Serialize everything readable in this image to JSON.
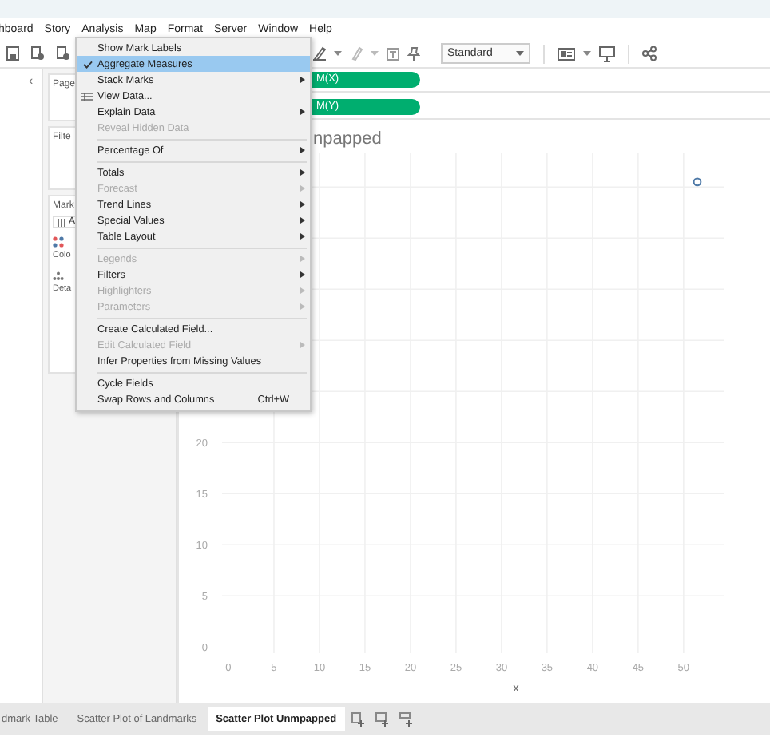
{
  "menubar": {
    "items": [
      {
        "label": "hboard"
      },
      {
        "label": "Story"
      },
      {
        "label": "Analysis"
      },
      {
        "label": "Map"
      },
      {
        "label": "Format"
      },
      {
        "label": "Server"
      },
      {
        "label": "Window"
      },
      {
        "label": "Help"
      }
    ]
  },
  "toolbar": {
    "mark_size": "Standard"
  },
  "data_pane": {
    "collapse": "‹"
  },
  "cards": {
    "pages": "Page",
    "filters": "Filte",
    "marks": "Mark",
    "marks_type": "A",
    "color_label": "Colo",
    "detail_label": "Deta"
  },
  "shelves": {
    "columns_pill": "M(X)",
    "rows_pill": "M(Y)"
  },
  "view": {
    "title": "npapped",
    "chart_data": {
      "type": "scatter",
      "grid": true,
      "xlabel": "x",
      "xlim": [
        -0.7,
        54.4
      ],
      "ylim": [
        -0.6,
        48.3
      ],
      "xticks": [
        0,
        5,
        10,
        15,
        20,
        25,
        30,
        35,
        40,
        45,
        50
      ],
      "yticks": [
        0,
        5,
        10,
        15,
        20
      ],
      "series": [
        {
          "color": "#4e79a7",
          "x": [
            51.5
          ],
          "values": [
            45.5
          ]
        }
      ]
    }
  },
  "analysis_menu": {
    "items": [
      {
        "kind": "item",
        "label": "Show Mark Labels",
        "checked": false,
        "selected": false,
        "disabled": false,
        "submenu": false
      },
      {
        "kind": "item",
        "label": "Aggregate Measures",
        "checked": true,
        "selected": true,
        "disabled": false,
        "submenu": false
      },
      {
        "kind": "item",
        "label": "Stack Marks",
        "checked": false,
        "selected": false,
        "disabled": false,
        "submenu": true
      },
      {
        "kind": "item",
        "label": "View Data...",
        "checked": false,
        "selected": false,
        "disabled": false,
        "submenu": false,
        "icon": true
      },
      {
        "kind": "item",
        "label": "Explain Data",
        "checked": false,
        "selected": false,
        "disabled": false,
        "submenu": true
      },
      {
        "kind": "item",
        "label": "Reveal Hidden Data",
        "checked": false,
        "selected": false,
        "disabled": true,
        "submenu": false
      },
      {
        "kind": "separator"
      },
      {
        "kind": "item",
        "label": "Percentage Of",
        "checked": false,
        "selected": false,
        "disabled": false,
        "submenu": true
      },
      {
        "kind": "separator"
      },
      {
        "kind": "item",
        "label": "Totals",
        "checked": false,
        "selected": false,
        "disabled": false,
        "submenu": true
      },
      {
        "kind": "item",
        "label": "Forecast",
        "checked": false,
        "selected": false,
        "disabled": true,
        "submenu": true
      },
      {
        "kind": "item",
        "label": "Trend Lines",
        "checked": false,
        "selected": false,
        "disabled": false,
        "submenu": true
      },
      {
        "kind": "item",
        "label": "Special Values",
        "checked": false,
        "selected": false,
        "disabled": false,
        "submenu": true
      },
      {
        "kind": "item",
        "label": "Table Layout",
        "checked": false,
        "selected": false,
        "disabled": false,
        "submenu": true
      },
      {
        "kind": "separator"
      },
      {
        "kind": "item",
        "label": "Legends",
        "checked": false,
        "selected": false,
        "disabled": true,
        "submenu": true
      },
      {
        "kind": "item",
        "label": "Filters",
        "checked": false,
        "selected": false,
        "disabled": false,
        "submenu": true
      },
      {
        "kind": "item",
        "label": "Highlighters",
        "checked": false,
        "selected": false,
        "disabled": true,
        "submenu": true
      },
      {
        "kind": "item",
        "label": "Parameters",
        "checked": false,
        "selected": false,
        "disabled": true,
        "submenu": true
      },
      {
        "kind": "separator"
      },
      {
        "kind": "item",
        "label": "Create Calculated Field...",
        "checked": false,
        "selected": false,
        "disabled": false,
        "submenu": false
      },
      {
        "kind": "item",
        "label": "Edit Calculated Field",
        "checked": false,
        "selected": false,
        "disabled": true,
        "submenu": true
      },
      {
        "kind": "item",
        "label": "Infer Properties from Missing Values",
        "checked": false,
        "selected": false,
        "disabled": false,
        "submenu": false
      },
      {
        "kind": "separator"
      },
      {
        "kind": "item",
        "label": "Cycle Fields",
        "checked": false,
        "selected": false,
        "disabled": false,
        "submenu": false
      },
      {
        "kind": "item",
        "label": "Swap Rows and Columns",
        "checked": false,
        "selected": false,
        "disabled": false,
        "submenu": false,
        "shortcut": "Ctrl+W"
      }
    ]
  },
  "sheet_tabs": [
    {
      "label": "dmark Table",
      "selected": false
    },
    {
      "label": "Scatter Plot of Landmarks",
      "selected": false
    },
    {
      "label": "Scatter Plot Unmpapped",
      "selected": true
    }
  ]
}
